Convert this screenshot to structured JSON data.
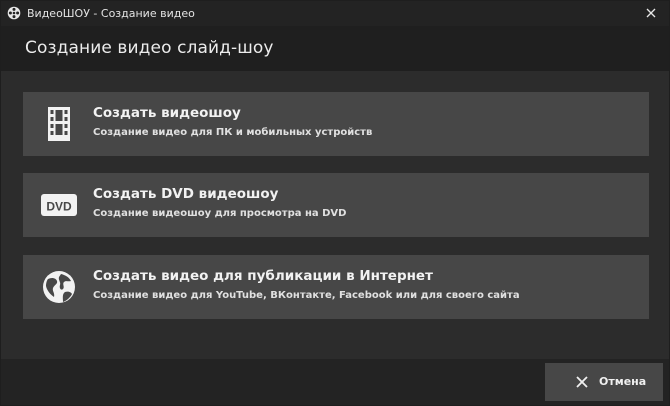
{
  "window": {
    "title": "ВидеоШОУ - Создание видео"
  },
  "header": {
    "title": "Создание видео слайд-шоу"
  },
  "options": [
    {
      "icon": "film-strip-icon",
      "title": "Создать видеошоу",
      "subtitle": "Создание видео для ПК и мобильных устройств"
    },
    {
      "icon": "dvd-icon",
      "icon_text": "DVD",
      "title": "Создать DVD видеошоу",
      "subtitle": "Создание видеошоу для просмотра на DVD"
    },
    {
      "icon": "globe-icon",
      "title": "Создать видео для публикации в Интернет",
      "subtitle": "Создание видео для YouTube, ВКонтакте, Facebook или для своего сайта"
    }
  ],
  "footer": {
    "cancel_label": "Отмена"
  },
  "colors": {
    "titlebar": "#232323",
    "header": "#1f1f1f",
    "content": "#2c2c2c",
    "option_bg": "#474747",
    "text": "#f2f2f2"
  }
}
